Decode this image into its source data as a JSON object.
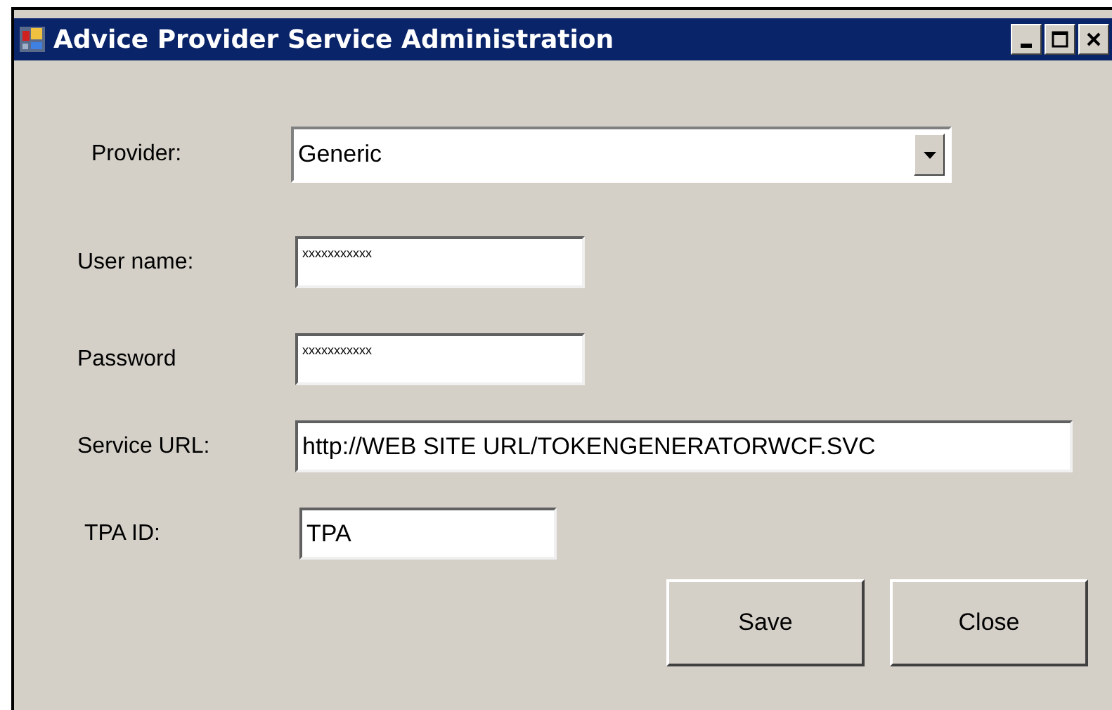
{
  "window": {
    "title": "Advice Provider Service Administration"
  },
  "fields": [
    {
      "kind": "combo",
      "label": "Provider:",
      "value": "Generic"
    },
    {
      "kind": "text",
      "label": "User name:",
      "value": "xxxxxxxxxxx"
    },
    {
      "kind": "text",
      "label": "Password",
      "value": "xxxxxxxxxxx"
    },
    {
      "kind": "text",
      "label": "Service URL:",
      "value": "http://WEB SITE URL/TOKENGENERATORWCF.SVC"
    },
    {
      "kind": "text",
      "label": "TPA ID:",
      "value": "TPA"
    }
  ],
  "buttons": [
    "Save",
    "Close"
  ]
}
